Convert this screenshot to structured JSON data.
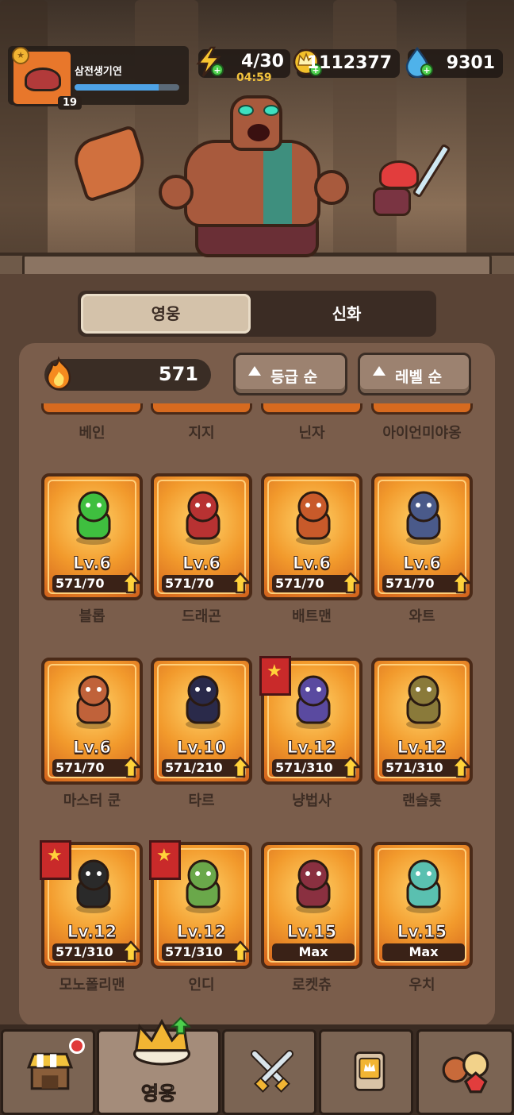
{
  "profile": {
    "name": "삼전생기연",
    "level": "19",
    "exp_fraction": 0.8
  },
  "resources": {
    "energy": {
      "value": "4/30",
      "timer": "04:59",
      "icon": "lightning-icon"
    },
    "gold": {
      "value": "1112377",
      "icon": "crown-coin-icon"
    },
    "gem": {
      "value": "9301",
      "icon": "gem-icon"
    }
  },
  "tabs": {
    "heroes": "영웅",
    "myth": "신화"
  },
  "power": {
    "value": "571",
    "icon": "fire-icon"
  },
  "sort": {
    "grade": "등급 순",
    "level": "레벨 순"
  },
  "cut_row": [
    "베인",
    "지지",
    "닌자",
    "아이언미야옹"
  ],
  "heroes": [
    {
      "name": "블롭",
      "level": "Lv.6",
      "progress": "571/70",
      "starred": false,
      "color": "#3fbf3f"
    },
    {
      "name": "드래곤",
      "level": "Lv.6",
      "progress": "571/70",
      "starred": false,
      "color": "#b83232"
    },
    {
      "name": "배트맨",
      "level": "Lv.6",
      "progress": "571/70",
      "starred": false,
      "color": "#c85a2a"
    },
    {
      "name": "와트",
      "level": "Lv.6",
      "progress": "571/70",
      "starred": false,
      "color": "#4a5a8a"
    },
    {
      "name": "마스터 쿤",
      "level": "Lv.6",
      "progress": "571/70",
      "starred": false,
      "color": "#c0623a"
    },
    {
      "name": "타르",
      "level": "Lv.10",
      "progress": "571/210",
      "starred": false,
      "color": "#2a2a4a"
    },
    {
      "name": "냥법사",
      "level": "Lv.12",
      "progress": "571/310",
      "starred": true,
      "color": "#5a4aa0"
    },
    {
      "name": "랜슬롯",
      "level": "Lv.12",
      "progress": "571/310",
      "starred": false,
      "color": "#8a7a3a"
    },
    {
      "name": "모노폴리맨",
      "level": "Lv.12",
      "progress": "571/310",
      "starred": true,
      "color": "#2a2a2a"
    },
    {
      "name": "인디",
      "level": "Lv.12",
      "progress": "571/310",
      "starred": true,
      "color": "#6aa84a"
    },
    {
      "name": "로켓츄",
      "level": "Lv.15",
      "progress": "Max",
      "starred": false,
      "color": "#8a3040"
    },
    {
      "name": "우치",
      "level": "Lv.15",
      "progress": "Max",
      "starred": false,
      "color": "#5ac0b0"
    }
  ],
  "nav": {
    "shop": {
      "icon": "shop-icon"
    },
    "heroes": {
      "label": "영웅",
      "icon": "crown-icon"
    },
    "battle": {
      "icon": "crossed-swords-icon"
    },
    "cards": {
      "icon": "card-icon"
    },
    "party": {
      "icon": "party-icon"
    }
  }
}
